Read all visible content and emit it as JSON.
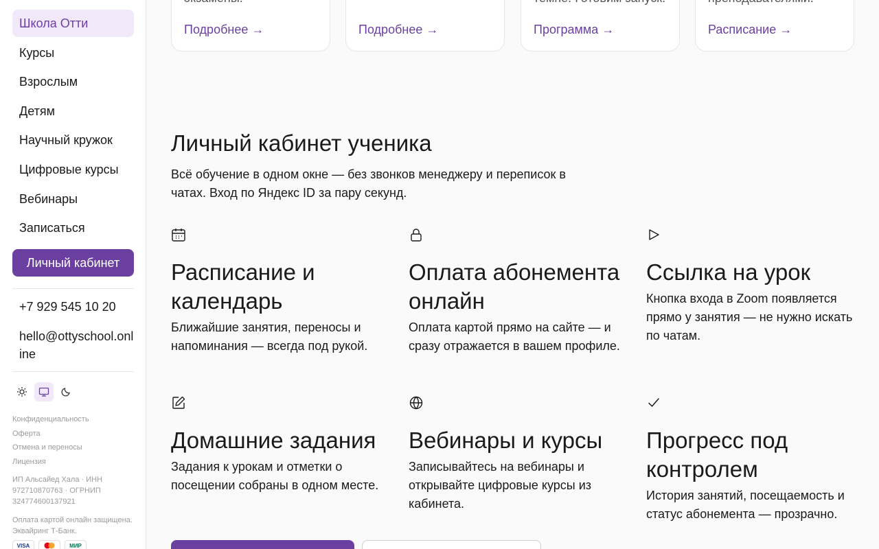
{
  "sidebar": {
    "nav": [
      "Школа Отти",
      "Курсы",
      "Взрослым",
      "Детям",
      "Научный кружок",
      "Цифровые курсы",
      "Вебинары",
      "Записаться"
    ],
    "cabinet_button": "Личный кабинет",
    "phone": "+7 929 545 10 20",
    "email": "hello@ottyschool.online",
    "theme_options": [
      "sun-icon",
      "monitor-icon",
      "moon-icon"
    ],
    "links": [
      "Конфиденциальность",
      "Оферта",
      "Отмена и переносы",
      "Лицензия"
    ],
    "legal": "ИП Альсайед Хала · ИНН 972710870763 · ОГРНИП 324774600137921",
    "payment_note": "Оплата картой онлайн защищена. Эквайринг Т-Банк.",
    "payment_badges": [
      "VISA",
      "Mastercard",
      "МИР"
    ]
  },
  "cards": [
    {
      "text": "экзамены.",
      "link": "Подробнее →"
    },
    {
      "text": "",
      "link": "Подробнее →"
    },
    {
      "text": "темпе. Готовим запуск.",
      "link": "Программа →"
    },
    {
      "text": "преподавателями.",
      "link": "Расписание →"
    }
  ],
  "cabinet": {
    "title": "Личный кабинет ученика",
    "description": "Всё обучение в одном окне — без звонков менеджеру и переписок в чатах. Вход по Яндекс ID за пару секунд."
  },
  "features": [
    {
      "icon": "calendar-icon",
      "title": "Расписание и календарь",
      "desc": "Ближайшие занятия, переносы и напоминания — всегда под рукой."
    },
    {
      "icon": "lock-icon",
      "title": "Оплата абонемента онлайн",
      "desc": "Оплата картой прямо на сайте — и сразу отражается в вашем профиле."
    },
    {
      "icon": "play-icon",
      "title": "Ссылка на урок",
      "desc": "Кнопка входа в Zoom появляется прямо у занятия — не нужно искать по чатам."
    },
    {
      "icon": "edit-icon",
      "title": "Домашние задания",
      "desc": "Задания к урокам и отметки о посещении собраны в одном месте."
    },
    {
      "icon": "globe-icon",
      "title": "Вебинары и курсы",
      "desc": "Записывайтесь на вебинары и открывайте цифровые курсы из кабинета."
    },
    {
      "icon": "check-icon",
      "title": "Прогресс под контролем",
      "desc": "История занятий, посещаемость и статус абонемента — прозрачно."
    }
  ],
  "colors": {
    "accent": "#6b3fa0",
    "accent_light": "#f1e9fa"
  }
}
